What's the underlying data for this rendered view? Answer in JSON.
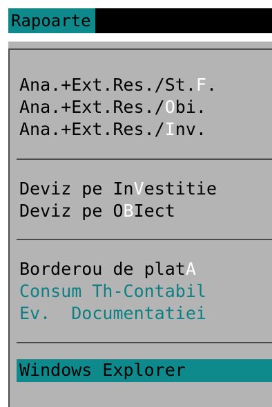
{
  "menu": {
    "title": "Rapoarte",
    "items": [
      {
        "pre": "Ana.+Ext.Res./St.",
        "hot": "F",
        "post": "."
      },
      {
        "pre": "Ana.+Ext.Res./",
        "hot": "O",
        "post": "bi."
      },
      {
        "pre": "Ana.+Ext.Res./",
        "hot": "I",
        "post": "nv."
      },
      {
        "pre": "Deviz pe In",
        "hot": "V",
        "post": "estitie"
      },
      {
        "pre": "Deviz pe O",
        "hot": "B",
        "post": "Iect"
      },
      {
        "pre": "Borderou de plat",
        "hot": "A",
        "post": ""
      },
      {
        "label": "Consum Th-Contabil"
      },
      {
        "label": "Ev.  Documentatiei"
      },
      {
        "label": "Windows Explorer"
      }
    ]
  },
  "colors": {
    "accent": "#0e8a8c",
    "disabled_text": "#0e7f82",
    "panel": "#b4b4b4",
    "hotkey": "#ffffff"
  }
}
